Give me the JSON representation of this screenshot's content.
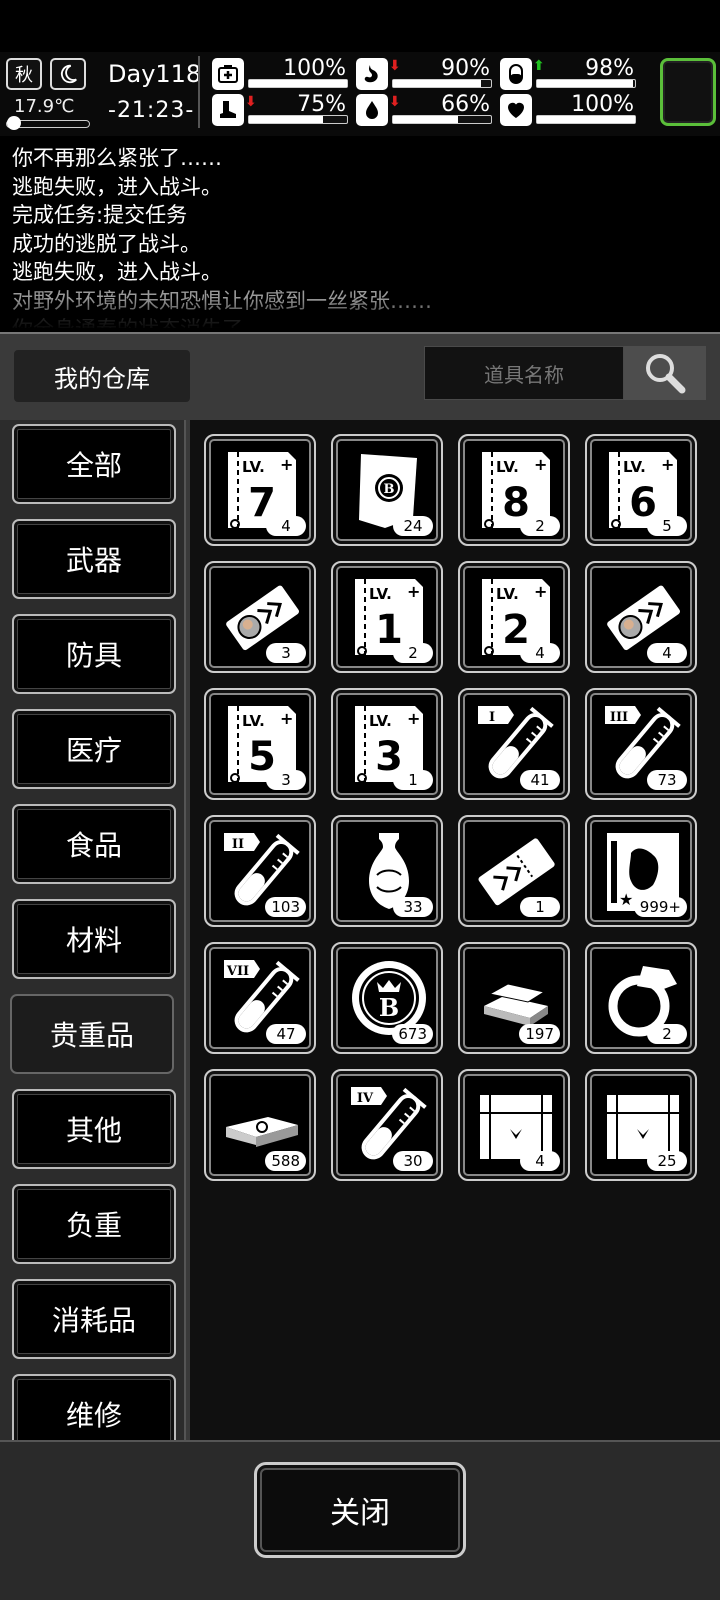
{
  "hud": {
    "season": "秋",
    "temperature": "17.9℃",
    "day": "Day118",
    "time": "-21:23-",
    "stats": [
      {
        "name": "health",
        "icon": "medkit-icon",
        "value": "100%",
        "fraction": 1.0,
        "trend": ""
      },
      {
        "name": "hunger",
        "icon": "stomach-icon",
        "value": "90%",
        "fraction": 0.9,
        "trend": "down"
      },
      {
        "name": "mood",
        "icon": "pill-icon",
        "value": "98%",
        "fraction": 0.98,
        "trend": "up"
      },
      {
        "name": "stamina",
        "icon": "boot-icon",
        "value": "75%",
        "fraction": 0.75,
        "trend": "down"
      },
      {
        "name": "thirst",
        "icon": "water-drop-icon",
        "value": "66%",
        "fraction": 0.66,
        "trend": "down"
      },
      {
        "name": "heart",
        "icon": "heart-icon",
        "value": "100%",
        "fraction": 1.0,
        "trend": ""
      }
    ],
    "colors": {
      "trend_down": "#e02020",
      "trend_up": "#20c020",
      "frame_green": "#5bbf3a"
    }
  },
  "log": [
    "你不再那么紧张了……",
    "逃跑失败，进入战斗。",
    "完成任务:提交任务",
    "成功的逃脱了战斗。",
    "逃跑失败，进入战斗。",
    "对野外环境的未知恐惧让你感到一丝紧张……",
    "你全身通泰的状态消失了。"
  ],
  "warehouse": {
    "title": "我的仓库",
    "search_placeholder": "道具名称"
  },
  "categories": [
    "全部",
    "武器",
    "防具",
    "医疗",
    "食品",
    "材料",
    "贵重品",
    "其他",
    "负重",
    "消耗品",
    "维修"
  ],
  "active_category": "贵重品",
  "items": [
    {
      "type": "skillbook",
      "level": "7",
      "count": "4"
    },
    {
      "type": "bcoin-paper",
      "count": "24"
    },
    {
      "type": "skillbook",
      "level": "8",
      "count": "2"
    },
    {
      "type": "skillbook",
      "level": "6",
      "count": "5"
    },
    {
      "type": "ticket-portrait",
      "count": "3"
    },
    {
      "type": "skillbook",
      "level": "1",
      "count": "2"
    },
    {
      "type": "skillbook",
      "level": "2",
      "count": "4"
    },
    {
      "type": "ticket-portrait",
      "count": "4"
    },
    {
      "type": "skillbook",
      "level": "5",
      "count": "3"
    },
    {
      "type": "skillbook",
      "level": "3",
      "count": "1"
    },
    {
      "type": "potion",
      "level": "I",
      "count": "41"
    },
    {
      "type": "potion",
      "level": "III",
      "count": "73"
    },
    {
      "type": "potion",
      "level": "II",
      "count": "103"
    },
    {
      "type": "vase",
      "count": "33"
    },
    {
      "type": "ticket",
      "count": "1"
    },
    {
      "type": "poster",
      "count": "999+"
    },
    {
      "type": "potion",
      "level": "VII",
      "count": "47"
    },
    {
      "type": "bcoin",
      "count": "673"
    },
    {
      "type": "gold-bars",
      "count": "197"
    },
    {
      "type": "ring",
      "count": "2"
    },
    {
      "type": "cash-stack",
      "count": "588"
    },
    {
      "type": "potion",
      "level": "IV",
      "count": "30"
    },
    {
      "type": "crate",
      "count": "4"
    },
    {
      "type": "crate",
      "count": "25"
    }
  ],
  "footer": {
    "close_label": "关闭"
  }
}
